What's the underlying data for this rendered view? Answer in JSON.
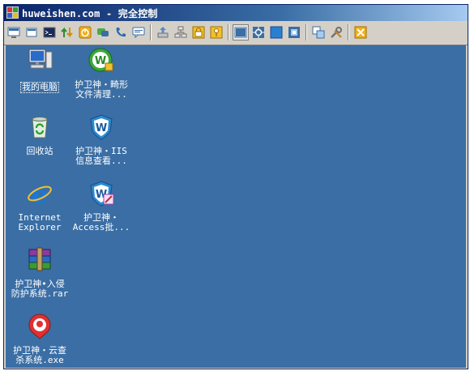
{
  "window": {
    "title": "huweishen.com - 完全控制"
  },
  "toolbar": {
    "buttons": [
      {
        "name": "fullscreen-icon",
        "color": "#3a6ea5"
      },
      {
        "name": "window-icon",
        "color": "#3a6ea5"
      },
      {
        "name": "console-icon",
        "color": "#2a4a8a"
      },
      {
        "name": "transfer-icon",
        "color": "#2e8b2e"
      },
      {
        "name": "power-icon",
        "color": "#e8a000"
      },
      {
        "name": "chat-icon",
        "color": "#3a9a3a"
      },
      {
        "name": "phone-icon",
        "color": "#2a6ab0"
      },
      {
        "name": "message-icon",
        "color": "#3a6ea5"
      },
      {
        "name": "upload-icon",
        "color": "#5a8ac5"
      },
      {
        "name": "network-icon",
        "color": "#707070"
      },
      {
        "name": "lock-icon",
        "color": "#d9a400"
      },
      {
        "name": "key-icon",
        "color": "#c89000"
      },
      {
        "name": "view-normal-icon",
        "color": "#3a6ea5"
      },
      {
        "name": "fit-icon",
        "color": "#3a6ea5"
      },
      {
        "name": "blank-screen-icon",
        "color": "#2a80d0"
      },
      {
        "name": "settings-icon",
        "color": "#3a6ea5"
      },
      {
        "name": "copy-icon",
        "color": "#3a6ea5"
      },
      {
        "name": "tools-icon",
        "color": "#707070"
      },
      {
        "name": "close-session-icon",
        "color": "#e8a000"
      }
    ]
  },
  "desktop": {
    "icons": [
      {
        "label": "我的电脑"
      },
      {
        "label": "护卫神・畸形\n文件清理..."
      },
      {
        "label": "回收站"
      },
      {
        "label": "护卫神・IIS\n信息查看..."
      },
      {
        "label": "Internet\nExplorer"
      },
      {
        "label": "护卫神・\nAccess批..."
      },
      {
        "label": "护卫神•入侵\n防护系统.rar"
      },
      {
        "label": "护卫神・云查\n杀系统.exe"
      }
    ]
  }
}
